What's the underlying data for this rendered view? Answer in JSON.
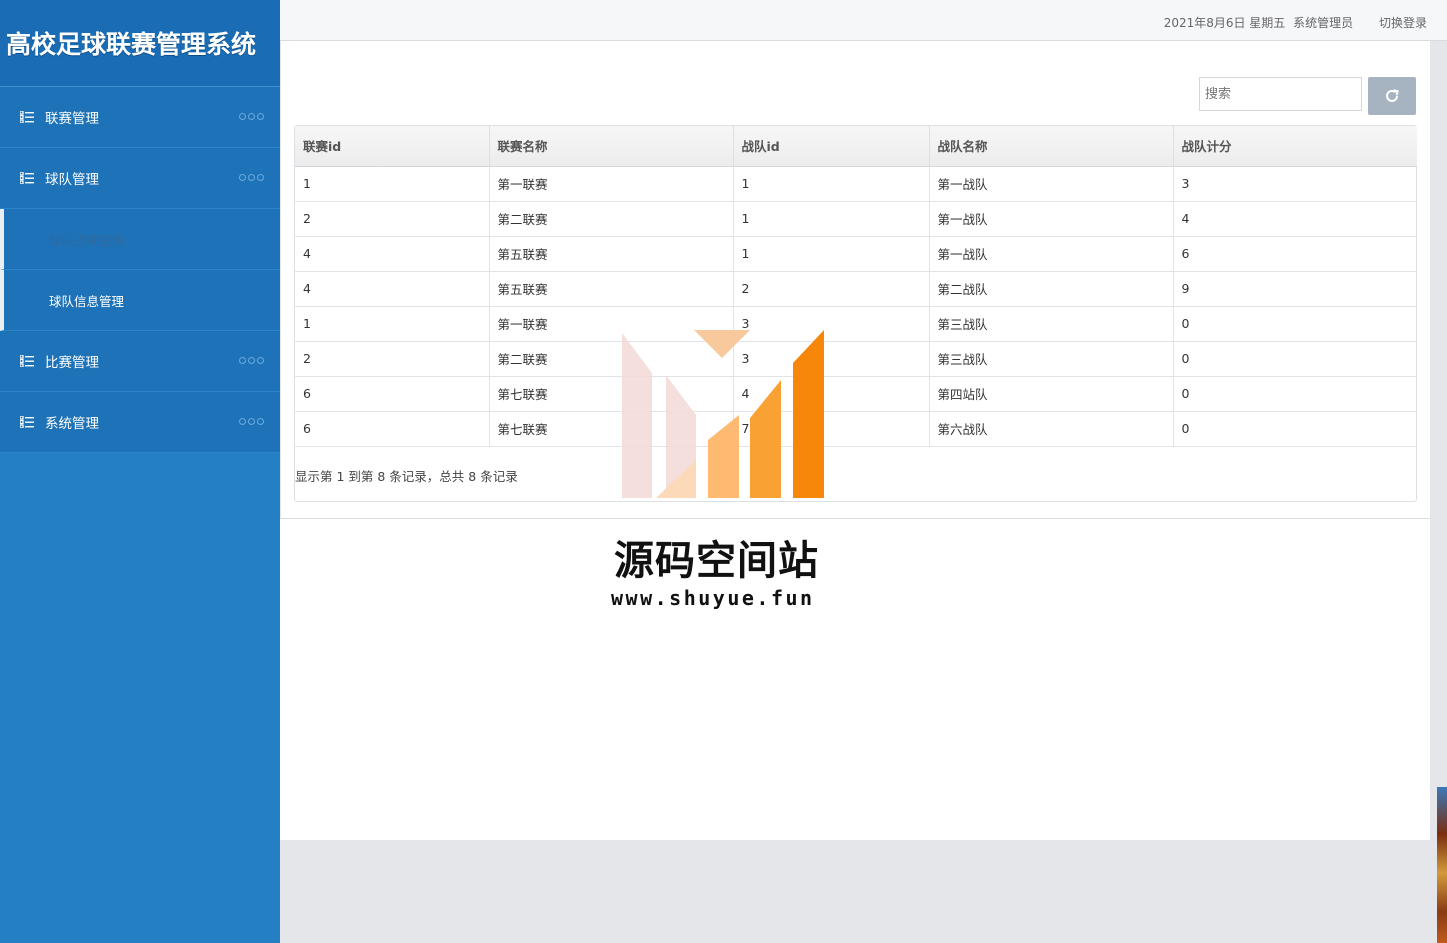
{
  "app": {
    "title": "高校足球联赛管理系统"
  },
  "sidebar": {
    "items": [
      {
        "label": "联赛管理",
        "icon": "list-icon"
      },
      {
        "label": "球队管理",
        "icon": "list-icon",
        "children": [
          {
            "label": "球队战绩查询"
          },
          {
            "label": "球队信息管理"
          }
        ]
      },
      {
        "label": "比赛管理",
        "icon": "list-icon"
      },
      {
        "label": "系统管理",
        "icon": "list-icon"
      }
    ]
  },
  "header": {
    "date": "2021年8月6日 星期五",
    "user": "系统管理员",
    "switch_login": "切换登录"
  },
  "search": {
    "placeholder": "搜索"
  },
  "table": {
    "columns": [
      "联赛id",
      "联赛名称",
      "战队id",
      "战队名称",
      "战队计分"
    ],
    "rows": [
      [
        "1",
        "第一联赛",
        "1",
        "第一战队",
        "3"
      ],
      [
        "2",
        "第二联赛",
        "1",
        "第一战队",
        "4"
      ],
      [
        "4",
        "第五联赛",
        "1",
        "第一战队",
        "6"
      ],
      [
        "4",
        "第五联赛",
        "2",
        "第二战队",
        "9"
      ],
      [
        "1",
        "第一联赛",
        "3",
        "第三战队",
        "0"
      ],
      [
        "2",
        "第二联赛",
        "3",
        "第三战队",
        "0"
      ],
      [
        "6",
        "第七联赛",
        "4",
        "第四站队",
        "0"
      ],
      [
        "6",
        "第七联赛",
        "7",
        "第六战队",
        "0"
      ]
    ],
    "pagination": "显示第 1 到第 8 条记录，总共 8 条记录"
  },
  "watermark": {
    "title": "源码空间站",
    "url": "www.shuyue.fun"
  },
  "colors": {
    "sidebar": "#2580c3",
    "sidebar_dark": "#1e73b8",
    "refresh_button": "#a6b4c1",
    "watermark_orange": "#f7870a"
  }
}
